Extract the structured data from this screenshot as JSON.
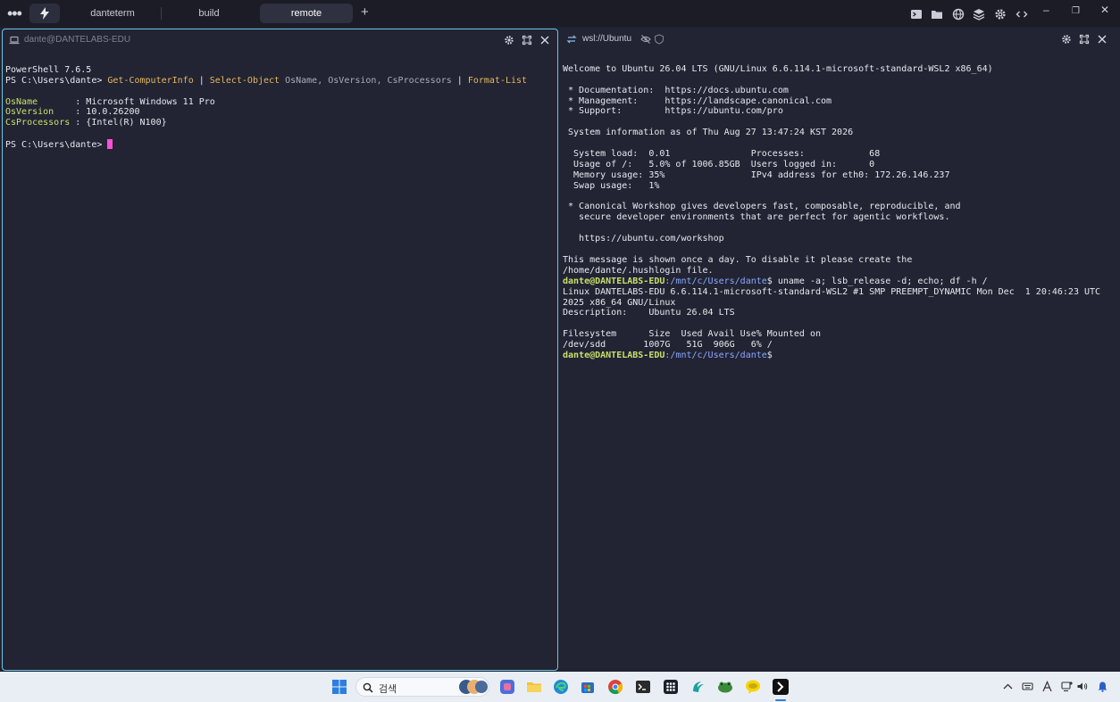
{
  "topbar": {
    "tabs": [
      {
        "label": "danteterm"
      },
      {
        "label": "build"
      },
      {
        "label": "remote"
      }
    ],
    "add_tab": "+",
    "window_controls": [
      "–",
      "❐",
      "✕"
    ]
  },
  "left_pane": {
    "title": "dante@DANTELABS-EDU",
    "lines": {
      "l1": "PowerShell 7.6.5",
      "prompt1": "PS C:\\Users\\dante> ",
      "cmd_a": "Get-ComputerInfo",
      "pipe1": " | ",
      "cmd_b": "Select-Object",
      "args1": " OsName",
      "comma1": ",",
      "args2": " OsVersion",
      "comma2": ",",
      "args3": " CsProcessors",
      "pipe2": " | ",
      "cmd_c": "Format-List",
      "k1": "OsName",
      "v1": "       : Microsoft Windows 11 Pro",
      "k2": "OsVersion",
      "v2": "    : 10.0.26200",
      "k3": "CsProcessors",
      "v3": " : {Intel(R) N100}",
      "prompt2": "PS C:\\Users\\dante> "
    }
  },
  "right_pane": {
    "title": "wsl://Ubuntu",
    "lines": [
      "Welcome to Ubuntu 26.04 LTS (GNU/Linux 6.6.114.1-microsoft-standard-WSL2 x86_64)",
      "",
      " * Documentation:  https://docs.ubuntu.com",
      " * Management:     https://landscape.canonical.com",
      " * Support:        https://ubuntu.com/pro",
      "",
      " System information as of Thu Aug 27 13:47:24 KST 2026",
      "",
      "  System load:  0.01               Processes:            68",
      "  Usage of /:   5.0% of 1006.85GB  Users logged in:      0",
      "  Memory usage: 35%                IPv4 address for eth0: 172.26.146.237",
      "  Swap usage:   1%",
      "",
      " * Canonical Workshop gives developers fast, composable, reproducible, and",
      "   secure developer environments that are perfect for agentic workflows.",
      "",
      "   https://ubuntu.com/workshop",
      "",
      "This message is shown once a day. To disable it please create the",
      "/home/dante/.hushlogin file."
    ],
    "prompt_user": "dante@DANTELABS-EDU",
    "prompt_path": ":/mnt/c/Users/dante",
    "prompt_sign": "$ ",
    "command": "uname -a; lsb_release -d; echo; df -h /",
    "output": [
      "Linux DANTELABS-EDU 6.6.114.1-microsoft-standard-WSL2 #1 SMP PREEMPT_DYNAMIC Mon Dec  1 20:46:23 UTC",
      "2025 x86_64 GNU/Linux",
      "Description:    Ubuntu 26.04 LTS",
      "",
      "Filesystem      Size  Used Avail Use% Mounted on",
      "/dev/sdd       1007G   51G  906G   6% /"
    ]
  },
  "taskbar": {
    "search_label": "검색"
  },
  "colors": {
    "accent_border": "#6cc4e8",
    "cursor": "#ff4fd8",
    "cmdlet": "#e6b85a",
    "key": "#c8e06a",
    "path": "#8aa8ff"
  }
}
